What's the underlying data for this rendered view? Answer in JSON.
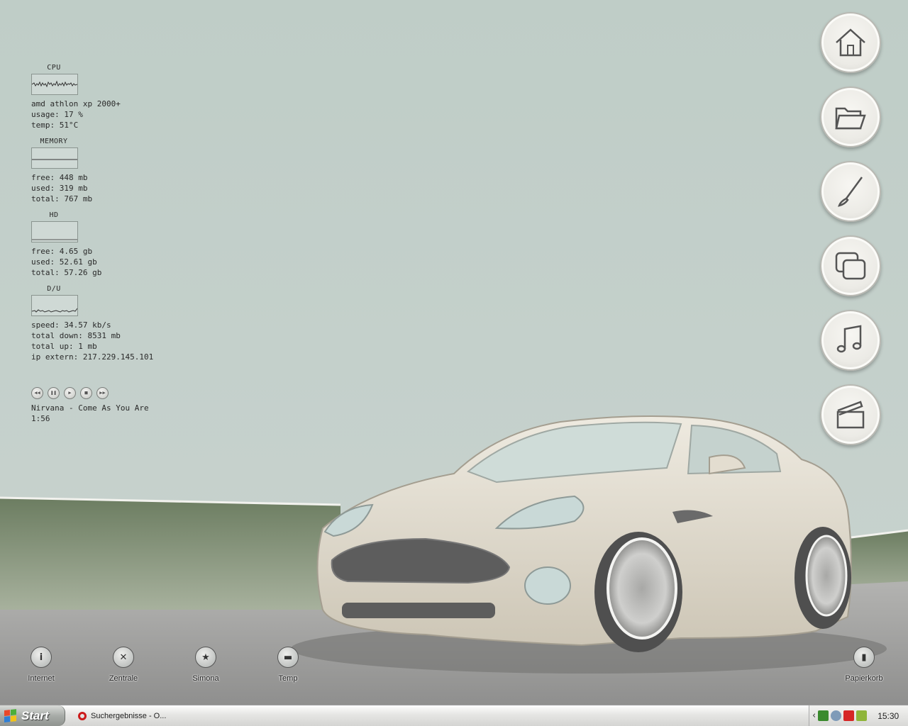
{
  "monitor": {
    "cpu": {
      "title": "CPU",
      "model": "amd athlon xp 2000+",
      "usage": "usage: 17 %",
      "temp": "temp: 51°C"
    },
    "memory": {
      "title": "MEMORY",
      "free": "free: 448 mb",
      "used": "used: 319 mb",
      "total": "total: 767 mb"
    },
    "hd": {
      "title": "HD",
      "free": "free: 4.65 gb",
      "used": "used: 52.61 gb",
      "total": "total: 57.26 gb"
    },
    "du": {
      "title": "D/U",
      "speed": "speed: 34.57 kb/s",
      "total_down": "total down: 8531 mb",
      "total_up": "total up: 1 mb",
      "ip": "ip extern: 217.229.145.101"
    }
  },
  "player": {
    "track": "Nirvana - Come As You Are",
    "time": "1:56",
    "buttons": [
      "rewind-icon",
      "pause-icon",
      "play-icon",
      "stop-icon",
      "forward-icon"
    ]
  },
  "dock": [
    "home-icon",
    "folder-icon",
    "brush-icon",
    "windows-icon",
    "music-note-icon",
    "clapperboard-icon"
  ],
  "desktop_icons": {
    "internet": {
      "label": "Internet",
      "icon": "info-icon"
    },
    "zentrale": {
      "label": "Zentrale",
      "icon": "tools-icon"
    },
    "simona": {
      "label": "Simona",
      "icon": "star-icon"
    },
    "temp": {
      "label": "Temp",
      "icon": "folder-icon"
    },
    "papierkorb": {
      "label": "Papierkorb",
      "icon": "trash-icon"
    }
  },
  "taskbar": {
    "start_label": "Start",
    "task_label": "Suchergebnisse - O...",
    "clock": "15:30"
  },
  "colors": {
    "sky": "#c2d0cb",
    "hill": "#7c8e6e",
    "road": "#9a9a9a",
    "car": "#e3ddd0",
    "accent_red": "#cc1b1b"
  }
}
